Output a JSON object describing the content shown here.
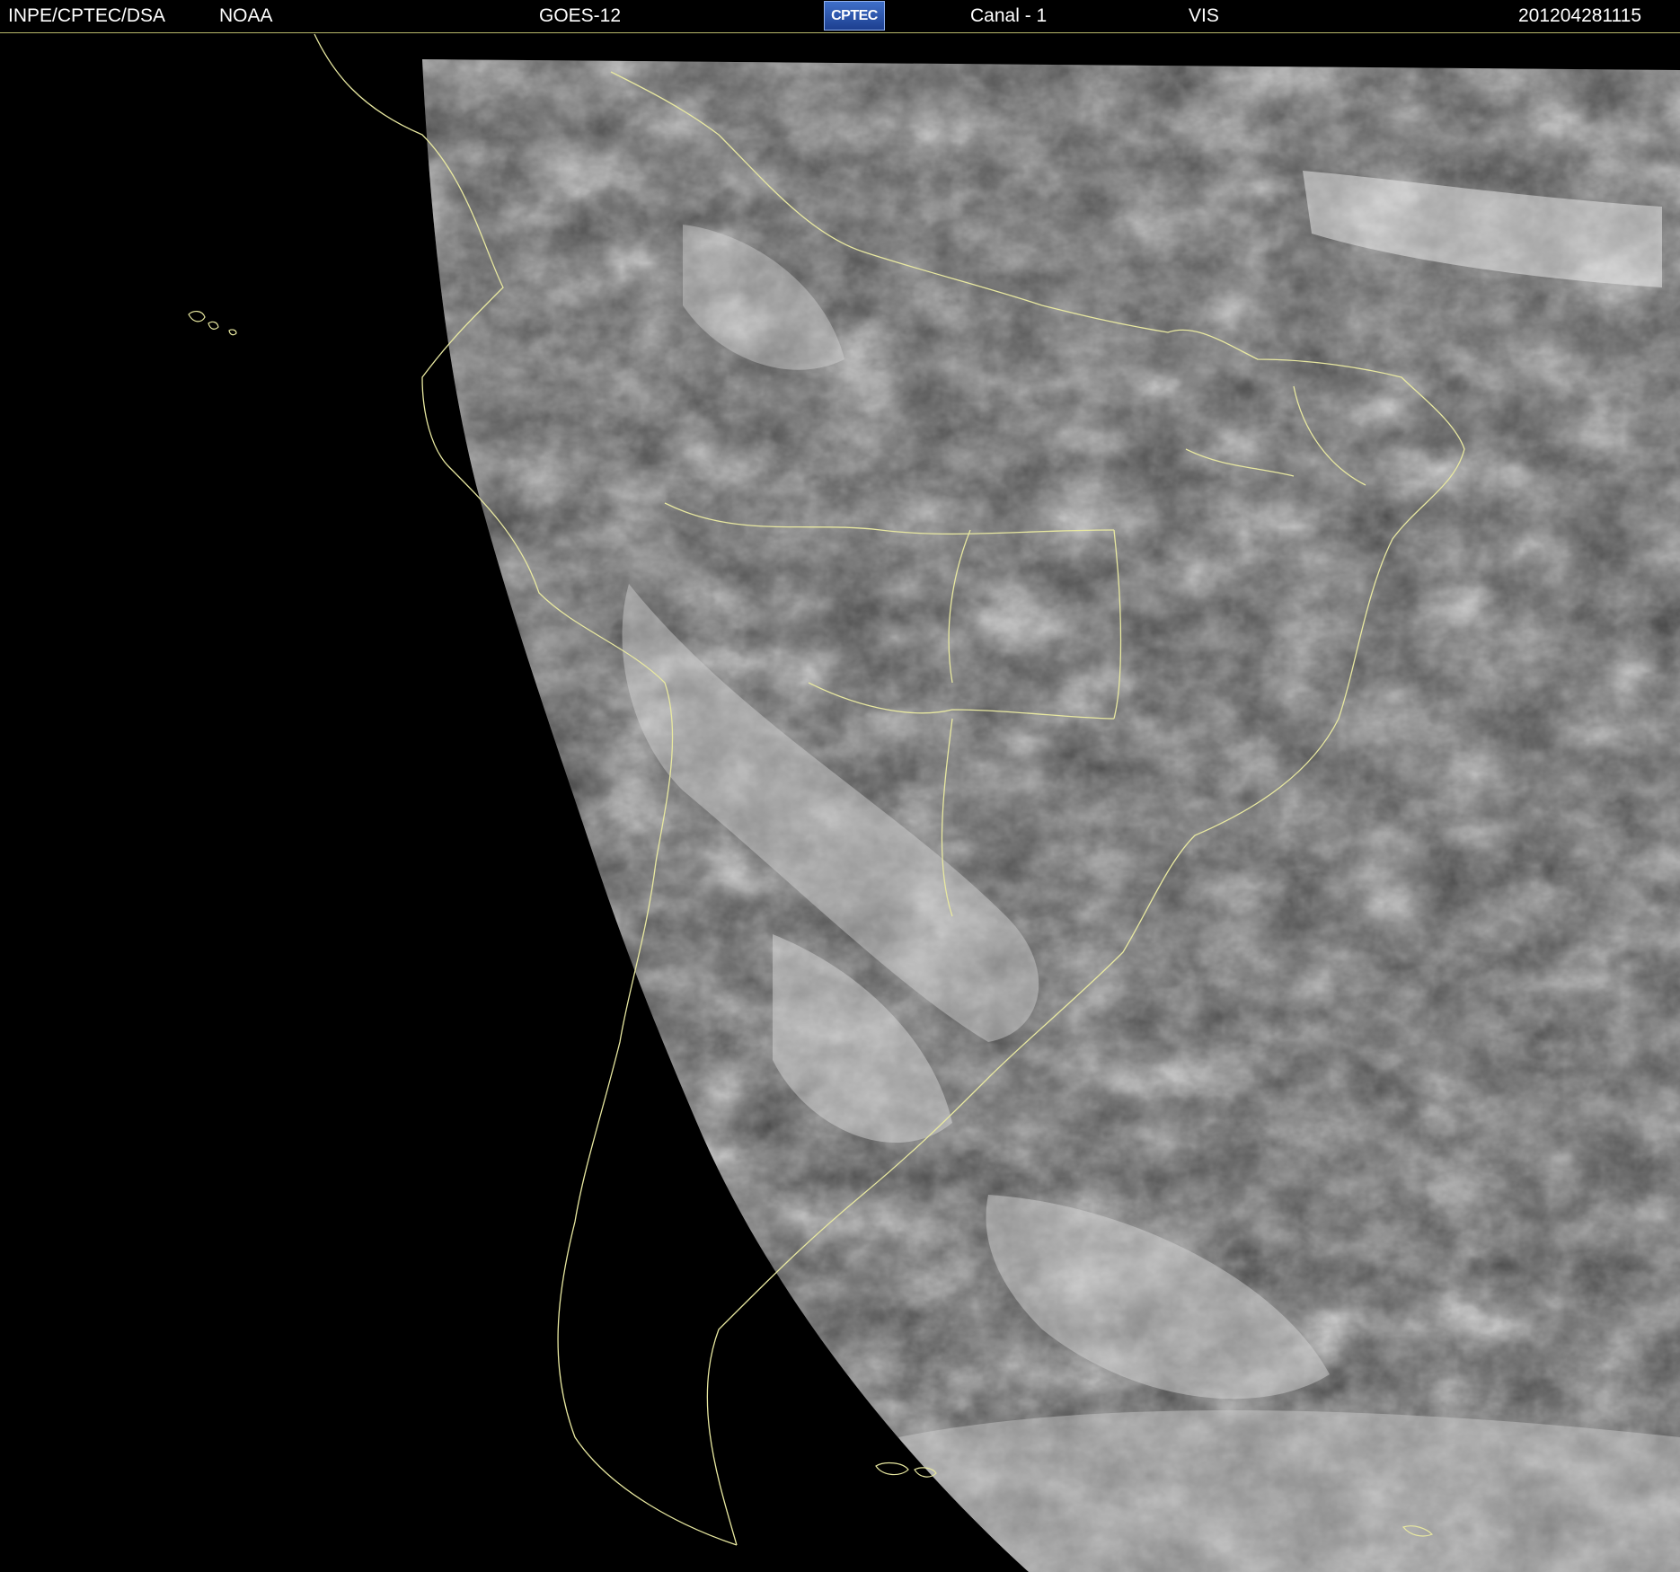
{
  "header": {
    "source": "INPE/CPTEC/DSA",
    "agency": "NOAA",
    "satellite": "GOES-12",
    "logo_text": "CPTEC",
    "channel": "Canal - 1",
    "band": "VIS",
    "timestamp": "201204281115"
  },
  "colors": {
    "background": "#000000",
    "coastline": "#e8e8a0",
    "header_text": "#ffffff",
    "logo": "#2f5cb8"
  },
  "image": {
    "description": "GOES-12 visible channel satellite image of South America and South Atlantic"
  }
}
